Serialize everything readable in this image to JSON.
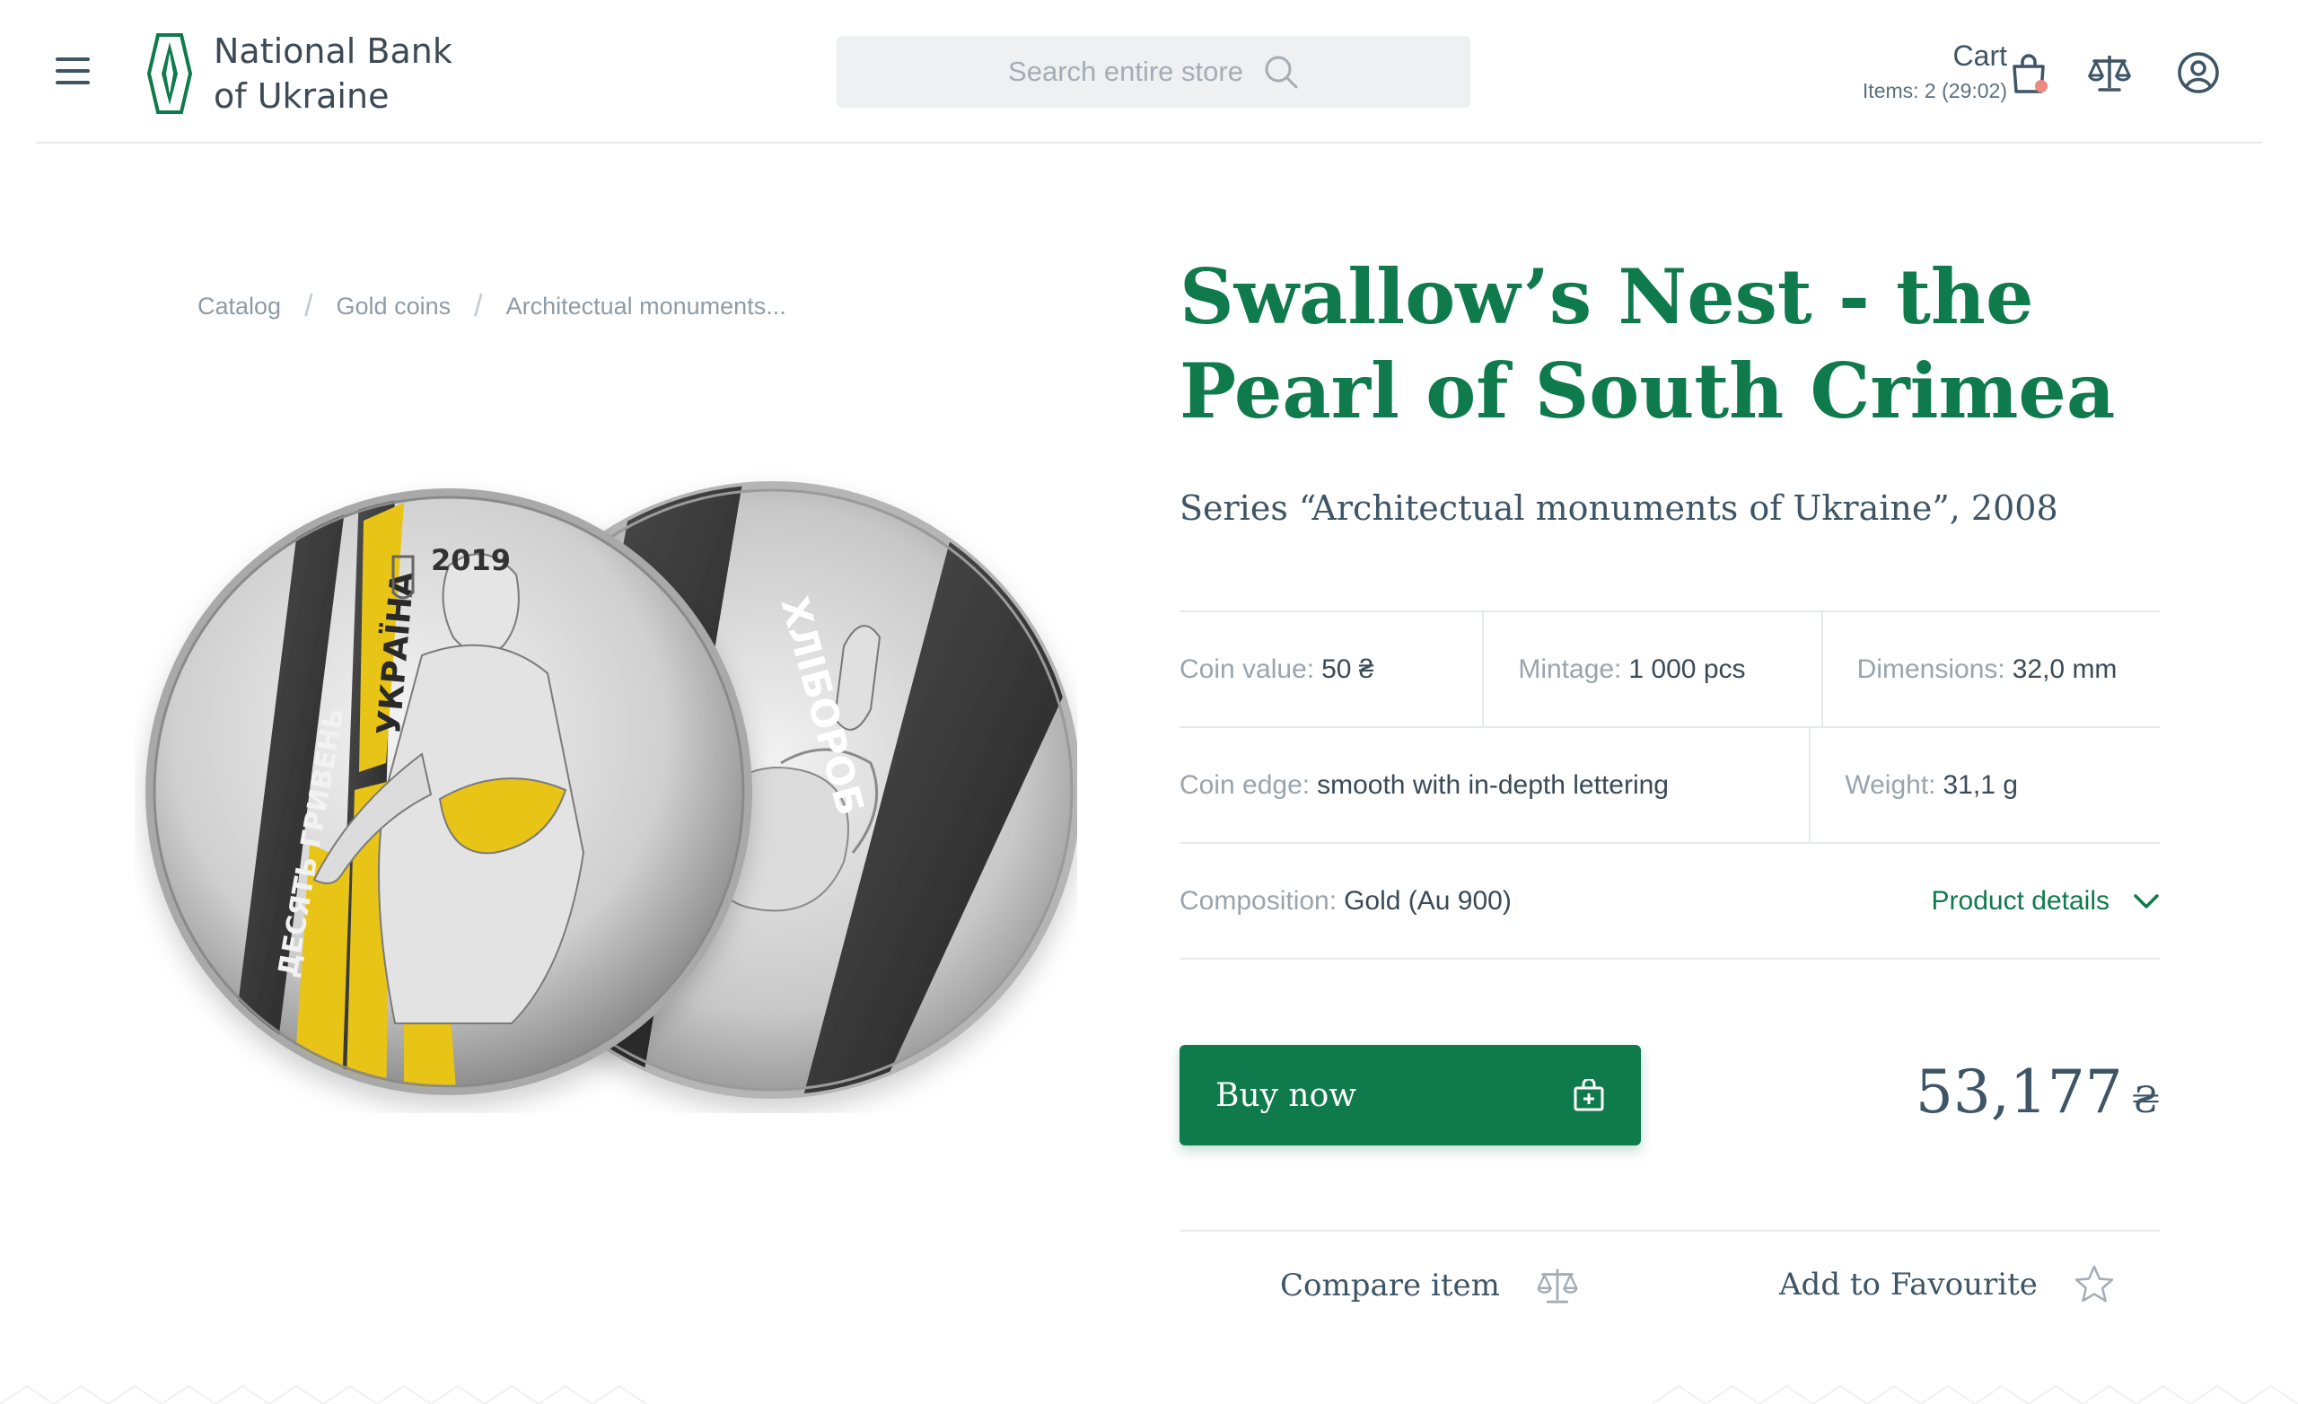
{
  "header": {
    "brand": {
      "line1": "National Bank",
      "line2": "of Ukraine"
    },
    "search": {
      "placeholder": "Search entire store"
    },
    "cart": {
      "title": "Cart",
      "items": "Items: 2 (29:02)"
    }
  },
  "breadcrumb": [
    "Catalog",
    "Gold coins",
    "Architectual monuments..."
  ],
  "product": {
    "title": "Swallow’s Nest - the Pearl of South Crimea",
    "series": "Series “Architectual monuments of Ukraine”, 2008",
    "coin_inscriptions": {
      "year": "2019",
      "country": "УКРАЇНА",
      "denomination": "ДЕСЯТЬ ГРИВЕНЬ",
      "reverse": "ХЛІБОРОБ"
    },
    "specs": {
      "coin_value": {
        "label": "Coin value:",
        "value": "50 ₴"
      },
      "mintage": {
        "label": "Mintage:",
        "value": "1 000 pcs"
      },
      "dimensions": {
        "label": "Dimensions:",
        "value": "32,0 mm"
      },
      "coin_edge": {
        "label": "Coin edge:",
        "value": "smooth with in-depth lettering"
      },
      "weight": {
        "label": "Weight:",
        "value": "31,1 g"
      },
      "composition": {
        "label": "Composition:",
        "value": "Gold (Au 900)"
      }
    },
    "details_link": "Product details",
    "buy_label": "Buy now",
    "price": {
      "amount": "53,177",
      "currency": "₴"
    },
    "compare_label": "Compare item",
    "favourite_label": "Add to Favourite"
  },
  "colors": {
    "brand_green": "#0f7a4b",
    "text": "#3d5566",
    "muted": "#9aa4ad",
    "gold": "#e8c417"
  }
}
